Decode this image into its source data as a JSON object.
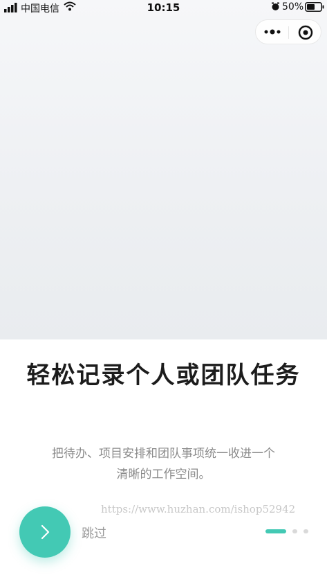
{
  "status_bar": {
    "carrier": "中国电信",
    "time": "10:15",
    "battery_percent": "50%",
    "icons": [
      "signal-icon",
      "wifi-icon",
      "alarm-icon",
      "battery-icon"
    ]
  },
  "capsule": {
    "icons": [
      "more-dots-icon",
      "target-circle-icon"
    ]
  },
  "onboarding": {
    "title": "轻松记录个人或团队任务",
    "subtitle_line1": "把待办、项目安排和团队事项统一收进一个",
    "subtitle_line2": "清晰的工作空间。",
    "skip_label": "跳过",
    "page_count": 3,
    "current_page": 1
  },
  "watermark": "https://www.huzhan.com/ishop52942",
  "colors": {
    "accent": "#43c9b4",
    "hero_background": "#eef0f3",
    "title": "#1c1c1c",
    "subtitle": "#8a8a8a"
  }
}
